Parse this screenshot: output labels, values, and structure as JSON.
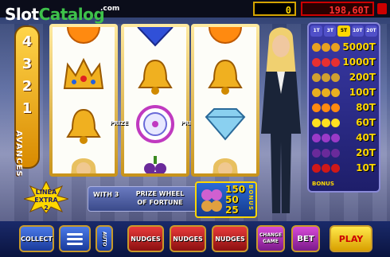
{
  "branding": {
    "logo_part1": "Slot",
    "logo_part2": "Catalog",
    "logo_com": ".com"
  },
  "header": {
    "bet_value": "0",
    "cash_value": "198,60T"
  },
  "avances": {
    "numbers": [
      "4",
      "3",
      "2",
      "1"
    ],
    "label": "AVANCES"
  },
  "reels": {
    "reel1": [
      "orange-icon",
      "crown-icon",
      "bell-icon",
      "woman-icon"
    ],
    "reel2": [
      "heart-bonus-icon",
      "bell-icon",
      "prize-wheel-icon",
      "grapes-icon"
    ],
    "reel3": [
      "orange-icon",
      "bell-icon",
      "diamond-icon",
      "woman-icon"
    ],
    "prize_label": "PRIZE"
  },
  "paytable": {
    "tabs": [
      "1T",
      "3T",
      "5T",
      "10T",
      "20T"
    ],
    "active_tab": 2,
    "rows": [
      {
        "symbol": "crown-icon",
        "value": "5000T",
        "color": "#e8a020"
      },
      {
        "symbol": "seven-icon",
        "value": "1000T",
        "color": "#e83030"
      },
      {
        "symbol": "bar-icon",
        "value": "200T",
        "color": "#d0a030"
      },
      {
        "symbol": "bell-icon",
        "value": "100T",
        "color": "#e8b020"
      },
      {
        "symbol": "orange-icon",
        "value": "80T",
        "color": "#ff8a10"
      },
      {
        "symbol": "lemon-icon",
        "value": "60T",
        "color": "#ffe020"
      },
      {
        "symbol": "plum-icon",
        "value": "40T",
        "color": "#9a3ac8"
      },
      {
        "symbol": "grapes-icon",
        "value": "20T",
        "color": "#6a2a9a"
      },
      {
        "symbol": "cherry-icon",
        "value": "10T",
        "color": "#d01818"
      }
    ],
    "bonus_label": "BONUS"
  },
  "linea_extra": {
    "line1": "LINEA",
    "line2": "EXTRA",
    "num": "2"
  },
  "prize_wheel": {
    "with_text": "WITH 3",
    "text_line1": "PRIZE WHEEL",
    "text_line2": "OF FORTUNE"
  },
  "bonus_panel": {
    "values": [
      "150",
      "50",
      "25"
    ],
    "word": "BONUS"
  },
  "buttons": {
    "collect": "COLLECT",
    "menu": "",
    "auto": "AUTO",
    "nudges1": "NUDGES",
    "nudges2": "NUDGES",
    "nudges3": "NUDGES",
    "change_game": "CHANGE GAME",
    "bet": "BET",
    "play": "PLAY"
  }
}
